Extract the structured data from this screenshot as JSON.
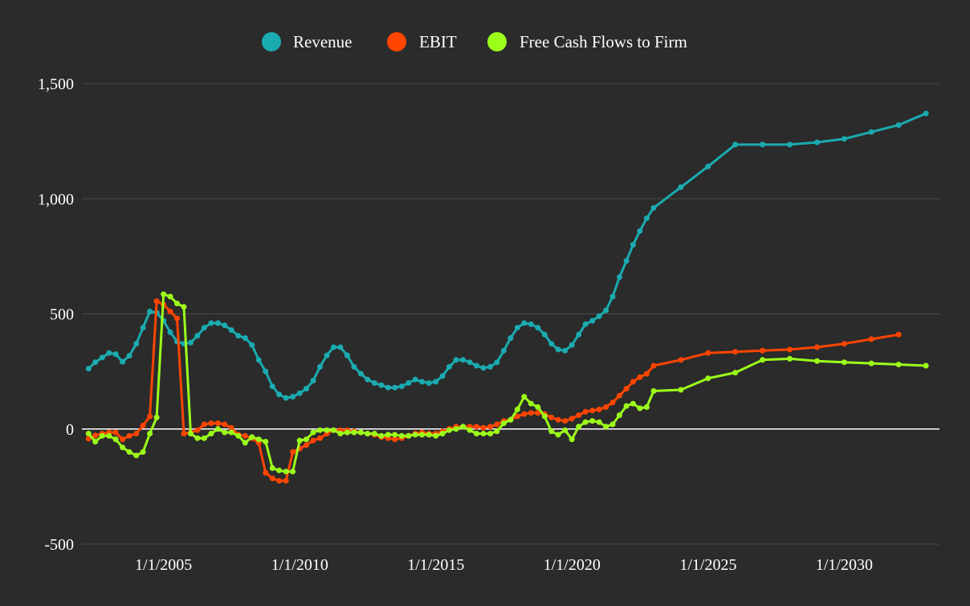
{
  "colors": {
    "background": "#2b2b2b",
    "grid": "#4a4a4a",
    "zero_line": "#ffffff",
    "text": "#ffffff"
  },
  "chart_data": {
    "type": "line",
    "title": "",
    "xlabel": "",
    "ylabel": "",
    "x_axis_type": "date",
    "xlim": [
      "2002-01-01",
      "2033-07-01"
    ],
    "ylim": [
      -500,
      1500
    ],
    "y_ticks": [
      -500,
      0,
      500,
      1000,
      1500
    ],
    "y_tick_labels": [
      "-500",
      "0",
      "500",
      "1,000",
      "1,500"
    ],
    "x_ticks": [
      "2005-01-01",
      "2010-01-01",
      "2015-01-01",
      "2020-01-01",
      "2025-01-01",
      "2030-01-01"
    ],
    "x_tick_labels": [
      "1/1/2005",
      "1/1/2010",
      "1/1/2015",
      "1/1/2020",
      "1/1/2025",
      "1/1/2030"
    ],
    "grid": true,
    "legend_position": "top-center",
    "x": [
      "2002-03-31",
      "2002-06-30",
      "2002-09-30",
      "2002-12-31",
      "2003-03-31",
      "2003-06-30",
      "2003-09-30",
      "2003-12-31",
      "2004-03-31",
      "2004-06-30",
      "2004-09-30",
      "2004-12-31",
      "2005-03-31",
      "2005-06-30",
      "2005-09-30",
      "2005-12-31",
      "2006-03-31",
      "2006-06-30",
      "2006-09-30",
      "2006-12-31",
      "2007-03-31",
      "2007-06-30",
      "2007-09-30",
      "2007-12-31",
      "2008-03-31",
      "2008-06-30",
      "2008-09-30",
      "2008-12-31",
      "2009-03-31",
      "2009-06-30",
      "2009-09-30",
      "2009-12-31",
      "2010-03-31",
      "2010-06-30",
      "2010-09-30",
      "2010-12-31",
      "2011-03-31",
      "2011-06-30",
      "2011-09-30",
      "2011-12-31",
      "2012-03-31",
      "2012-06-30",
      "2012-09-30",
      "2012-12-31",
      "2013-03-31",
      "2013-06-30",
      "2013-09-30",
      "2013-12-31",
      "2014-03-31",
      "2014-06-30",
      "2014-09-30",
      "2014-12-31",
      "2015-03-31",
      "2015-06-30",
      "2015-09-30",
      "2015-12-31",
      "2016-03-31",
      "2016-06-30",
      "2016-09-30",
      "2016-12-31",
      "2017-03-31",
      "2017-06-30",
      "2017-09-30",
      "2017-12-31",
      "2018-03-31",
      "2018-06-30",
      "2018-09-30",
      "2018-12-31",
      "2019-03-31",
      "2019-06-30",
      "2019-09-30",
      "2019-12-31",
      "2020-03-31",
      "2020-06-30",
      "2020-09-30",
      "2020-12-31",
      "2021-03-31",
      "2021-06-30",
      "2021-09-30",
      "2021-12-31",
      "2022-03-31",
      "2022-06-30",
      "2022-09-30",
      "2022-12-31",
      "2023-12-31",
      "2024-12-31",
      "2025-12-31",
      "2026-12-31",
      "2027-12-31",
      "2028-12-31",
      "2029-12-31",
      "2030-12-31",
      "2031-12-31",
      "2032-12-31",
      "2033-12-31"
    ],
    "series": [
      {
        "name": "Revenue",
        "color": "#1aabb0",
        "values": [
          262,
          290,
          310,
          330,
          325,
          292,
          318,
          370,
          440,
          510,
          505,
          470,
          420,
          380,
          370,
          375,
          405,
          440,
          460,
          460,
          450,
          430,
          405,
          395,
          365,
          300,
          250,
          185,
          150,
          135,
          140,
          155,
          175,
          210,
          270,
          320,
          355,
          355,
          320,
          270,
          240,
          215,
          200,
          190,
          180,
          180,
          185,
          200,
          215,
          205,
          200,
          205,
          230,
          270,
          300,
          300,
          290,
          275,
          265,
          270,
          290,
          340,
          395,
          440,
          460,
          455,
          440,
          410,
          370,
          345,
          340,
          365,
          410,
          455,
          470,
          490,
          515,
          575,
          660,
          730,
          800,
          860,
          915,
          960,
          1050,
          1140,
          1235,
          1235,
          1235,
          1245,
          1260,
          1290,
          1320,
          1370
        ]
      },
      {
        "name": "EBIT",
        "color": "#ff4500",
        "values": [
          -42,
          -28,
          -20,
          -15,
          -15,
          -45,
          -30,
          -20,
          15,
          55,
          555,
          540,
          510,
          480,
          -20,
          -15,
          -5,
          20,
          25,
          25,
          20,
          5,
          -25,
          -30,
          -40,
          -60,
          -190,
          -215,
          -225,
          -225,
          -100,
          -85,
          -70,
          -50,
          -40,
          -20,
          -5,
          -5,
          -5,
          -10,
          -15,
          -20,
          -25,
          -35,
          -40,
          -45,
          -40,
          -30,
          -20,
          -15,
          -20,
          -20,
          -10,
          0,
          10,
          10,
          10,
          10,
          5,
          10,
          20,
          35,
          40,
          55,
          65,
          70,
          70,
          65,
          50,
          40,
          35,
          45,
          60,
          75,
          80,
          85,
          95,
          115,
          145,
          175,
          205,
          225,
          240,
          275,
          300,
          330,
          335,
          340,
          345,
          355,
          370,
          390,
          410
        ]
      },
      {
        "name": "Free Cash Flows to Firm",
        "color": "#9cff1a",
        "values": [
          -20,
          -55,
          -30,
          -30,
          -45,
          -80,
          -100,
          -115,
          -100,
          -20,
          50,
          585,
          575,
          545,
          530,
          -20,
          -40,
          -40,
          -20,
          0,
          -15,
          -15,
          -30,
          -60,
          -35,
          -45,
          -55,
          -170,
          -180,
          -185,
          -185,
          -50,
          -45,
          -15,
          -5,
          -5,
          -5,
          -20,
          -15,
          -15,
          -15,
          -20,
          -20,
          -30,
          -25,
          -25,
          -30,
          -30,
          -25,
          -25,
          -25,
          -30,
          -20,
          -5,
          0,
          10,
          -5,
          -20,
          -20,
          -20,
          -10,
          25,
          40,
          85,
          140,
          110,
          95,
          55,
          -10,
          -25,
          -5,
          -45,
          10,
          30,
          35,
          30,
          10,
          20,
          60,
          100,
          110,
          90,
          95,
          165,
          170,
          220,
          245,
          300,
          305,
          295,
          290,
          285,
          280,
          275
        ]
      }
    ]
  }
}
